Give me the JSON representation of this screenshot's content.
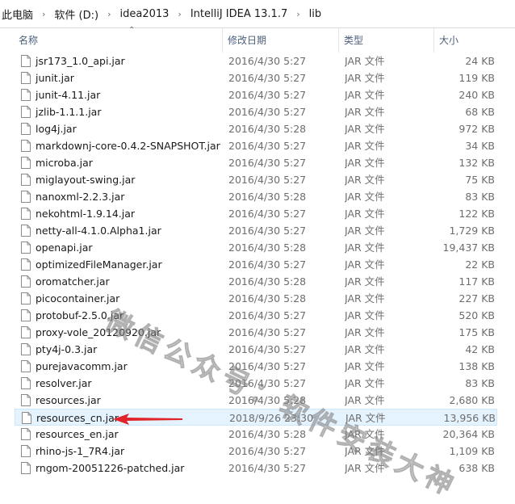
{
  "breadcrumb": {
    "items": [
      "此电脑",
      "软件 (D:)",
      "idea2013",
      "IntelliJ IDEA 13.1.7",
      "lib"
    ],
    "separator": "›"
  },
  "columns": {
    "name": "名称",
    "date": "修改日期",
    "type": "类型",
    "size": "大小"
  },
  "files": [
    {
      "name": "jsr173_1.0_api.jar",
      "date": "2016/4/30 5:27",
      "type": "JAR 文件",
      "size": "24 KB"
    },
    {
      "name": "junit.jar",
      "date": "2016/4/30 5:27",
      "type": "JAR 文件",
      "size": "119 KB"
    },
    {
      "name": "junit-4.11.jar",
      "date": "2016/4/30 5:27",
      "type": "JAR 文件",
      "size": "240 KB"
    },
    {
      "name": "jzlib-1.1.1.jar",
      "date": "2016/4/30 5:27",
      "type": "JAR 文件",
      "size": "68 KB"
    },
    {
      "name": "log4j.jar",
      "date": "2016/4/30 5:28",
      "type": "JAR 文件",
      "size": "972 KB"
    },
    {
      "name": "markdownj-core-0.4.2-SNAPSHOT.jar",
      "date": "2016/4/30 5:27",
      "type": "JAR 文件",
      "size": "34 KB"
    },
    {
      "name": "microba.jar",
      "date": "2016/4/30 5:27",
      "type": "JAR 文件",
      "size": "132 KB"
    },
    {
      "name": "miglayout-swing.jar",
      "date": "2016/4/30 5:27",
      "type": "JAR 文件",
      "size": "75 KB"
    },
    {
      "name": "nanoxml-2.2.3.jar",
      "date": "2016/4/30 5:28",
      "type": "JAR 文件",
      "size": "83 KB"
    },
    {
      "name": "nekohtml-1.9.14.jar",
      "date": "2016/4/30 5:27",
      "type": "JAR 文件",
      "size": "122 KB"
    },
    {
      "name": "netty-all-4.1.0.Alpha1.jar",
      "date": "2016/4/30 5:27",
      "type": "JAR 文件",
      "size": "1,729 KB"
    },
    {
      "name": "openapi.jar",
      "date": "2016/4/30 5:28",
      "type": "JAR 文件",
      "size": "19,437 KB"
    },
    {
      "name": "optimizedFileManager.jar",
      "date": "2016/4/30 5:27",
      "type": "JAR 文件",
      "size": "22 KB"
    },
    {
      "name": "oromatcher.jar",
      "date": "2016/4/30 5:28",
      "type": "JAR 文件",
      "size": "117 KB"
    },
    {
      "name": "picocontainer.jar",
      "date": "2016/4/30 5:28",
      "type": "JAR 文件",
      "size": "227 KB"
    },
    {
      "name": "protobuf-2.5.0.jar",
      "date": "2016/4/30 5:27",
      "type": "JAR 文件",
      "size": "520 KB"
    },
    {
      "name": "proxy-vole_20120920.jar",
      "date": "2016/4/30 5:27",
      "type": "JAR 文件",
      "size": "175 KB"
    },
    {
      "name": "pty4j-0.3.jar",
      "date": "2016/4/30 5:27",
      "type": "JAR 文件",
      "size": "42 KB"
    },
    {
      "name": "purejavacomm.jar",
      "date": "2016/4/30 5:27",
      "type": "JAR 文件",
      "size": "138 KB"
    },
    {
      "name": "resolver.jar",
      "date": "2016/4/30 5:27",
      "type": "JAR 文件",
      "size": "83 KB"
    },
    {
      "name": "resources.jar",
      "date": "2016/4/30 5:28",
      "type": "JAR 文件",
      "size": "2,680 KB"
    },
    {
      "name": "resources_cn.jar",
      "date": "2018/9/26 23:30",
      "type": "JAR 文件",
      "size": "13,956 KB",
      "selected": true
    },
    {
      "name": "resources_en.jar",
      "date": "2016/4/30 5:28",
      "type": "JAR 文件",
      "size": "20,364 KB"
    },
    {
      "name": "rhino-js-1_7R4.jar",
      "date": "2016/4/30 5:27",
      "type": "JAR 文件",
      "size": "1,109 KB"
    },
    {
      "name": "rngom-20051226-patched.jar",
      "date": "2016/4/30 5:27",
      "type": "JAR 文件",
      "size": "638 KB"
    }
  ],
  "watermark": "微信公众号：软件安装大神",
  "colors": {
    "selected_bg": "#e5f3ff",
    "selected_border": "#cce8ff",
    "header_text": "#4c607a",
    "annotation_arrow": "#e0242a"
  },
  "icons": {
    "file": "generic-file-icon",
    "sort": "sort-ascending-icon"
  }
}
